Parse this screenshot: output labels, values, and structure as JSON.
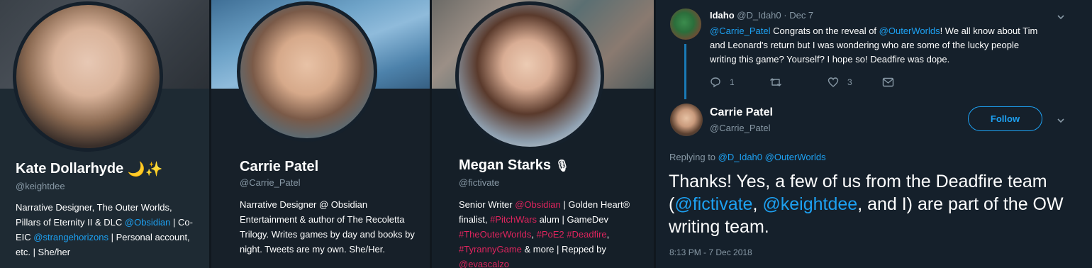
{
  "cards": [
    {
      "name": "Kate Dollarhyde",
      "name_emoji": "🌙✨",
      "handle": "@keightdee",
      "bio_segments": [
        {
          "text": "Narrative Designer, The Outer Worlds, Pillars of Eternity II & DLC ",
          "type": "text"
        },
        {
          "text": "@Obsidian",
          "type": "link"
        },
        {
          "text": " | Co-EIC ",
          "type": "text"
        },
        {
          "text": "@strangehorizons",
          "type": "link"
        },
        {
          "text": " | Personal account, etc. | She/her",
          "type": "text"
        }
      ]
    },
    {
      "name": "Carrie Patel",
      "handle": "@Carrie_Patel",
      "bio_segments": [
        {
          "text": "Narrative Designer @ Obsidian Entertainment & author of The Recoletta Trilogy. Writes games by day and books by night. Tweets are my own. She/Her.",
          "type": "text"
        }
      ]
    },
    {
      "name": "Megan Starks",
      "name_emoji": "🎙",
      "handle": "@fictivate",
      "bio_segments": [
        {
          "text": "Senior Writer ",
          "type": "text"
        },
        {
          "text": "@Obsidian",
          "type": "tag"
        },
        {
          "text": " | Golden Heart® finalist, ",
          "type": "text"
        },
        {
          "text": "#PitchWars",
          "type": "tag"
        },
        {
          "text": " alum | GameDev ",
          "type": "text"
        },
        {
          "text": "#TheOuterWorlds",
          "type": "tag"
        },
        {
          "text": ", ",
          "type": "text"
        },
        {
          "text": "#PoE2",
          "type": "tag"
        },
        {
          "text": " ",
          "type": "text"
        },
        {
          "text": "#Deadfire",
          "type": "tag"
        },
        {
          "text": ", ",
          "type": "text"
        },
        {
          "text": "#TyrannyGame",
          "type": "tag"
        },
        {
          "text": " & more | Repped by ",
          "type": "text"
        },
        {
          "text": "@evascalzo",
          "type": "tag"
        }
      ]
    }
  ],
  "reply": {
    "name": "Idaho",
    "meta": "@D_Idah0 · Dec 7",
    "text_segments": [
      {
        "text": "@Carrie_Patel",
        "type": "link"
      },
      {
        "text": " Congrats on the reveal of ",
        "type": "text"
      },
      {
        "text": "@OuterWorlds",
        "type": "link"
      },
      {
        "text": "! We all know about Tim and Leonard's return but I was wondering who are some of the lucky people writing this game? Yourself? I hope so! Deadfire was dope.",
        "type": "text"
      }
    ],
    "reply_count": "1",
    "retweet_count": "",
    "like_count": "3"
  },
  "main": {
    "name": "Carrie Patel",
    "handle": "@Carrie_Patel",
    "follow_label": "Follow",
    "replying_prefix": "Replying to ",
    "replying_to": [
      "@D_Idah0",
      "@OuterWorlds"
    ],
    "text_segments": [
      {
        "text": "Thanks! Yes, a few of us from the Deadfire team (",
        "type": "text"
      },
      {
        "text": "@fictivate",
        "type": "link"
      },
      {
        "text": ", ",
        "type": "text"
      },
      {
        "text": "@keightdee",
        "type": "link"
      },
      {
        "text": ", and I) are part of the OW writing team.",
        "type": "text"
      }
    ],
    "timestamp": "8:13 PM - 7 Dec 2018"
  },
  "colors": {
    "background": "#15202b",
    "link": "#1da1f2",
    "hashtag": "#e0245e",
    "muted": "#8899a6"
  }
}
